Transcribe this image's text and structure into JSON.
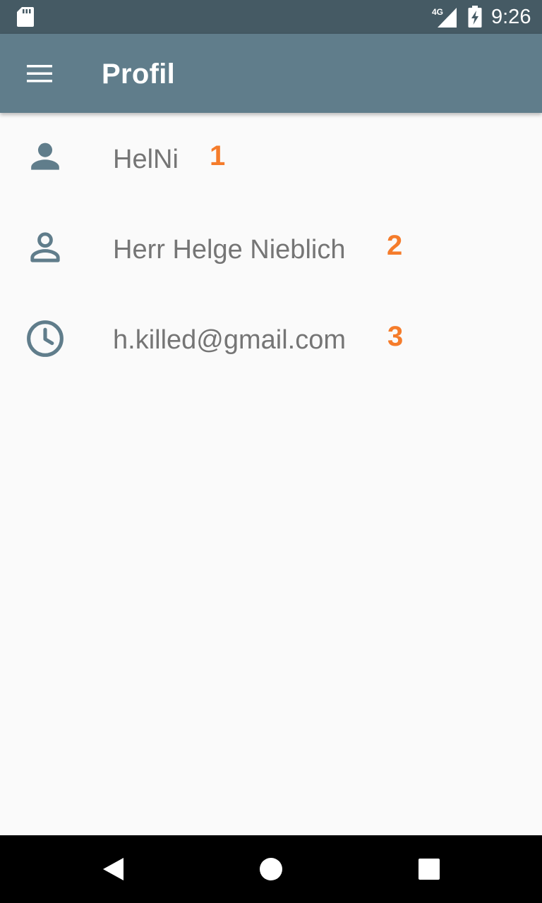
{
  "status_bar": {
    "network_type": "4G",
    "time": "9:26",
    "icons": [
      "sd-card-icon",
      "cellular-signal-icon",
      "battery-charging-icon"
    ]
  },
  "app_bar": {
    "title": "Profil",
    "menu_icon": "menu-icon"
  },
  "profile": {
    "items": [
      {
        "icon": "person-icon",
        "text": "HelNi",
        "marker": "1"
      },
      {
        "icon": "person-outline-icon",
        "text": "Herr Helge Nieblich",
        "marker": "2"
      },
      {
        "icon": "clock-icon",
        "text": "h.killed@gmail.com",
        "marker": "3"
      }
    ]
  },
  "nav_bar": {
    "icons": [
      "back-icon",
      "home-icon",
      "recents-icon"
    ]
  },
  "colors": {
    "status_bar": "#455a64",
    "app_bar": "#607d8b",
    "icon": "#607d8b",
    "text": "#757575",
    "marker": "#f57c2b",
    "background": "#fafafa"
  }
}
